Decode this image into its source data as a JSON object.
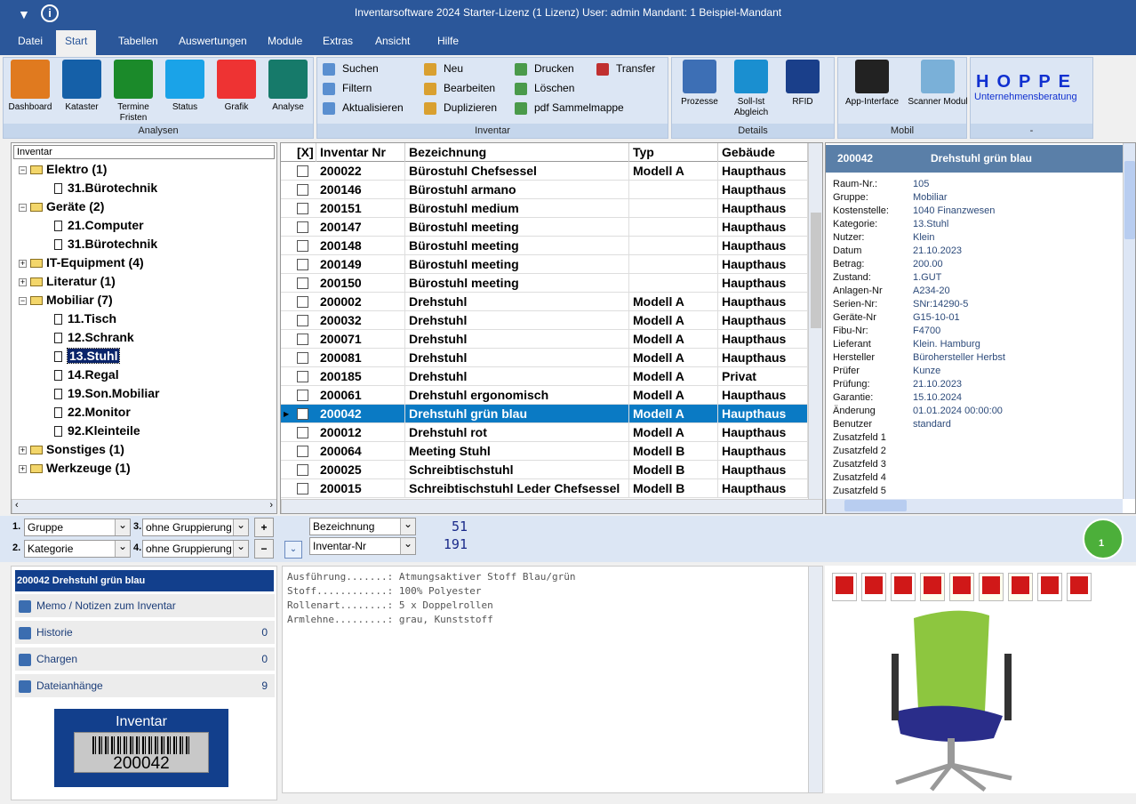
{
  "window": {
    "title": "Inventarsoftware 2024 Starter-Lizenz (1 Lizenz)   User: admin   Mandant: 1 Beispiel-Mandant"
  },
  "menu": [
    "Datei",
    "Start",
    "Tabellen",
    "Auswertungen",
    "Module",
    "Extras",
    "Ansicht",
    "Hilfe"
  ],
  "menu_active": "Start",
  "ribbon": {
    "analysen": {
      "label": "Analysen",
      "buttons": [
        "Dashboard",
        "Kataster",
        "Termine Fristen",
        "Status",
        "Grafik",
        "Analyse"
      ]
    },
    "inventar": {
      "label": "Inventar",
      "col1": [
        "Suchen",
        "Filtern",
        "Aktualisieren"
      ],
      "col2": [
        "Neu",
        "Bearbeiten",
        "Duplizieren"
      ],
      "col3": [
        "Drucken",
        "Löschen",
        "pdf Sammelmappe"
      ],
      "col4": [
        "Transfer"
      ]
    },
    "details": {
      "label": "Details",
      "buttons": [
        "Prozesse",
        "Soll-Ist Abgleich",
        "RFID"
      ]
    },
    "mobil": {
      "label": "Mobil",
      "buttons": [
        "App-Interface",
        "Scanner Modul"
      ]
    },
    "hoppe": {
      "label": "-",
      "logo_title": "HOPPE",
      "logo_sub": "Unternehmensberatung"
    }
  },
  "tree": {
    "header": "Inventar",
    "nodes": [
      {
        "label": "Elektro  (1)",
        "level": 0,
        "expanded": true
      },
      {
        "label": "31.Bürotechnik",
        "level": 1
      },
      {
        "label": "Geräte  (2)",
        "level": 0,
        "expanded": true
      },
      {
        "label": "21.Computer",
        "level": 1
      },
      {
        "label": "31.Bürotechnik",
        "level": 1
      },
      {
        "label": "IT-Equipment  (4)",
        "level": 0,
        "expanded": false
      },
      {
        "label": "Literatur  (1)",
        "level": 0,
        "expanded": false
      },
      {
        "label": "Mobiliar  (7)",
        "level": 0,
        "expanded": true
      },
      {
        "label": "11.Tisch",
        "level": 1
      },
      {
        "label": "12.Schrank",
        "level": 1
      },
      {
        "label": "13.Stuhl",
        "level": 1,
        "selected": true
      },
      {
        "label": "14.Regal",
        "level": 1
      },
      {
        "label": "19.Son.Mobiliar",
        "level": 1
      },
      {
        "label": "22.Monitor",
        "level": 1
      },
      {
        "label": "92.Kleinteile",
        "level": 1
      },
      {
        "label": "Sonstiges  (1)",
        "level": 0,
        "expanded": false
      },
      {
        "label": "Werkzeuge  (1)",
        "level": 0,
        "expanded": false
      }
    ]
  },
  "grid": {
    "columns": [
      "[X]",
      "Inventar Nr",
      "Bezeichnung",
      "Typ",
      "Gebäude"
    ],
    "rows": [
      [
        "200022",
        "Bürostuhl Chefsessel",
        "Modell A",
        "Haupthaus"
      ],
      [
        "200146",
        "Bürostuhl armano",
        "",
        "Haupthaus"
      ],
      [
        "200151",
        "Bürostuhl medium",
        "",
        "Haupthaus"
      ],
      [
        "200147",
        "Bürostuhl meeting",
        "",
        "Haupthaus"
      ],
      [
        "200148",
        "Bürostuhl meeting",
        "",
        "Haupthaus"
      ],
      [
        "200149",
        "Bürostuhl meeting",
        "",
        "Haupthaus"
      ],
      [
        "200150",
        "Bürostuhl meeting",
        "",
        "Haupthaus"
      ],
      [
        "200002",
        "Drehstuhl",
        "Modell A",
        "Haupthaus"
      ],
      [
        "200032",
        "Drehstuhl",
        "Modell A",
        "Haupthaus"
      ],
      [
        "200071",
        "Drehstuhl",
        "Modell A",
        "Haupthaus"
      ],
      [
        "200081",
        "Drehstuhl",
        "Modell A",
        "Haupthaus"
      ],
      [
        "200185",
        "Drehstuhl",
        "Modell A",
        "Privat"
      ],
      [
        "200061",
        "Drehstuhl ergonomisch",
        "Modell A",
        "Haupthaus"
      ],
      [
        "200042",
        "Drehstuhl grün blau",
        "Modell A",
        "Haupthaus"
      ],
      [
        "200012",
        "Drehstuhl rot",
        "Modell A",
        "Haupthaus"
      ],
      [
        "200064",
        "Meeting Stuhl",
        "Modell B",
        "Haupthaus"
      ],
      [
        "200025",
        "Schreibtischstuhl",
        "Modell B",
        "Haupthaus"
      ],
      [
        "200015",
        "Schreibtischstuhl Leder Chefsessel",
        "Modell B",
        "Haupthaus"
      ]
    ],
    "selected_index": 13
  },
  "detail": {
    "id": "200042",
    "title": "Drehstuhl grün blau",
    "fields": [
      [
        "Raum-Nr.:",
        "105"
      ],
      [
        "Gruppe:",
        "Mobiliar"
      ],
      [
        "Kostenstelle:",
        "1040 Finanzwesen"
      ],
      [
        "Kategorie:",
        "13.Stuhl"
      ],
      [
        "Nutzer:",
        "Klein"
      ],
      [
        "Datum",
        "21.10.2023"
      ],
      [
        "Betrag:",
        "200.00"
      ],
      [
        "Zustand:",
        "1.GUT"
      ],
      [
        "Anlagen-Nr",
        "A234-20"
      ],
      [
        "Serien-Nr:",
        "SNr:14290-5"
      ],
      [
        "Geräte-Nr",
        "G15-10-01"
      ],
      [
        "Fibu-Nr:",
        "F4700"
      ],
      [
        "Lieferant",
        "Klein. Hamburg"
      ],
      [
        "Hersteller",
        "Bürohersteller Herbst"
      ],
      [
        "Prüfer",
        "Kunze"
      ],
      [
        "Prüfung:",
        "21.10.2023"
      ],
      [
        "Garantie:",
        "15.10.2024"
      ],
      [
        "Änderung",
        "01.01.2024 00:00:00"
      ],
      [
        "Benutzer",
        "standard"
      ],
      [
        "Zusatzfeld 1",
        ""
      ],
      [
        "Zusatzfeld 2",
        ""
      ],
      [
        "Zusatzfeld 3",
        ""
      ],
      [
        "Zusatzfeld 4",
        ""
      ],
      [
        "Zusatzfeld 5",
        ""
      ]
    ]
  },
  "grouping": {
    "n1": "1.",
    "g1": "Gruppe",
    "n2": "2.",
    "g2": "Kategorie",
    "n3": "3.",
    "g3": "ohne Gruppierung",
    "n4": "4.",
    "g4": "ohne Gruppierung",
    "sort1": "Bezeichnung",
    "sort2": "Inventar-Nr",
    "count1": "51",
    "count2": "191",
    "user_badge": "1"
  },
  "bottom": {
    "header": "200042 Drehstuhl grün blau",
    "items": [
      {
        "label": "Memo / Notizen zum Inventar",
        "count": ""
      },
      {
        "label": "Historie",
        "count": "0"
      },
      {
        "label": "Chargen",
        "count": "0"
      },
      {
        "label": "Dateianhänge",
        "count": "9"
      }
    ],
    "label_title": "Inventar",
    "barcode": "200042",
    "memo": "Ausführung.......: Atmungsaktiver Stoff Blau/grün\nStoff............: 100% Polyester\nRollenart........: 5 x Doppelrollen\nArmlehne.........: grau, Kunststoff"
  },
  "attachments": [
    "pdf",
    "pdf",
    "pdf",
    "checklist",
    "checklist",
    "checklist",
    "checklist",
    "tools",
    "pdf"
  ],
  "colors": {
    "title_bar": "#2b579a",
    "ribbon": "#dce6f4",
    "selection": "#0a7ac4",
    "detail_header": "#5a7fa8",
    "label_bg": "#123f8c"
  }
}
